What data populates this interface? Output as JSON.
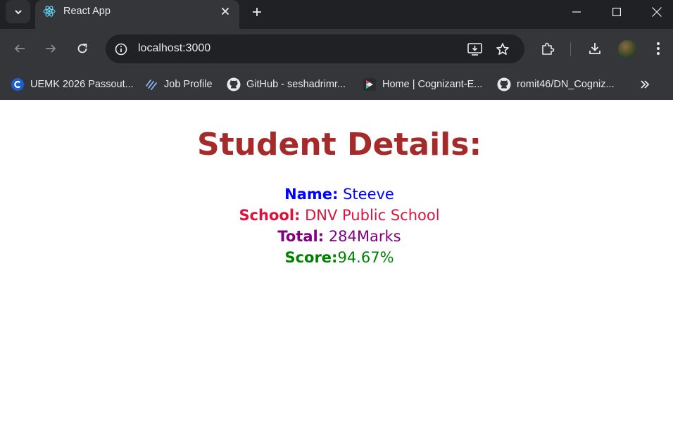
{
  "browser": {
    "tab": {
      "title": "React App"
    },
    "address_bar": {
      "url": "localhost:3000"
    },
    "bookmarks": [
      {
        "label": "UEMK 2026 Passout...",
        "icon": "uemk-icon"
      },
      {
        "label": "Job Profile",
        "icon": "job-profile-icon"
      },
      {
        "label": "GitHub - seshadrimr...",
        "icon": "github-icon"
      },
      {
        "label": "Home | Cognizant-E...",
        "icon": "cognizant-icon"
      },
      {
        "label": "romit46/DN_Cogniz...",
        "icon": "github-icon"
      }
    ]
  },
  "page": {
    "heading": "Student Details:",
    "details": [
      {
        "label": "Name:",
        "value": " Steeve",
        "color": "#0000ff"
      },
      {
        "label": "School:",
        "value": " DNV Public School",
        "color": "#dc143c"
      },
      {
        "label": "Total:",
        "value": " 284Marks",
        "color": "#800080"
      },
      {
        "label": "Score:",
        "value": "94.67%",
        "color": "#008000"
      }
    ]
  },
  "colors": {
    "heading": "#a52a2a",
    "chrome_dark": "#202124",
    "chrome_toolbar": "#35363a",
    "chrome_text": "#e8eaed"
  }
}
